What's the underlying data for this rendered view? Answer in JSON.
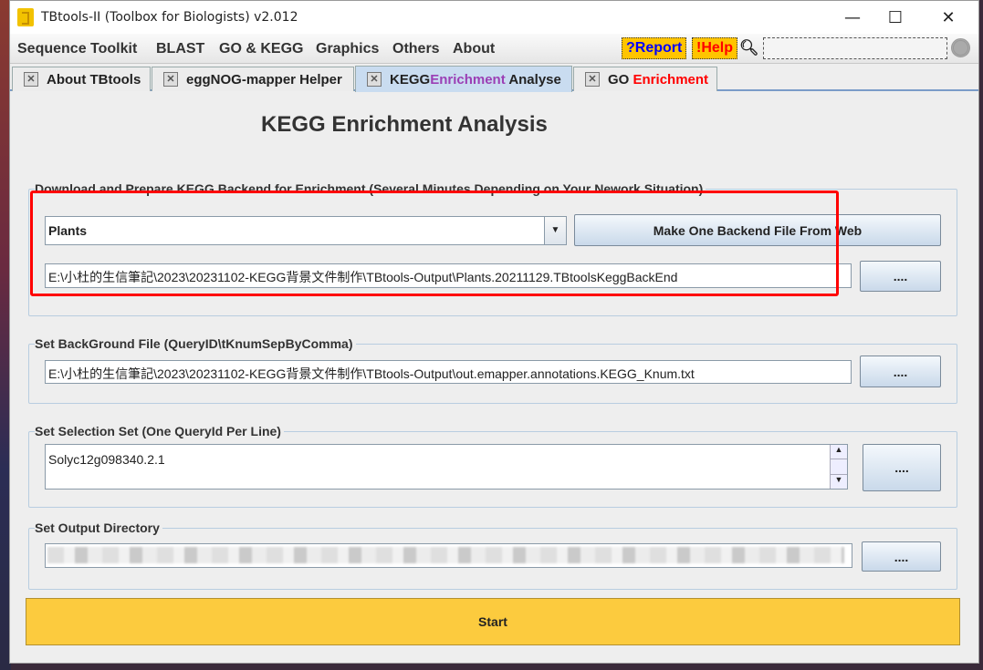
{
  "window": {
    "title": "TBtools-II (Toolbox for Biologists) v2.012",
    "minimize": "—",
    "maximize": "☐",
    "close": "✕"
  },
  "menu": {
    "items": [
      "Sequence Toolkit",
      "BLAST",
      "GO & KEGG",
      "Graphics",
      "Others",
      "About"
    ],
    "report": "?Report",
    "help": "!Help",
    "search_icon": "search-icon",
    "search_value": ""
  },
  "tabs": [
    {
      "pre": "About TBtools",
      "mid": "",
      "post": ""
    },
    {
      "pre": "eggNOG-mapper Helper",
      "mid": "",
      "post": ""
    },
    {
      "pre": "KEGG ",
      "mid": "Enrichment",
      "post": " Analyse",
      "mid_color": "#9b3fb5",
      "active": true
    },
    {
      "pre": "GO ",
      "mid": "Enrichment",
      "post": "",
      "mid_color": "#ff0000"
    }
  ],
  "page": {
    "heading": "KEGG Enrichment Analysis",
    "backend": {
      "label": "Download and Prepare KEGG Backend for Enrichment (Several Minutes Depending on Your Nework Situation)",
      "species": "Plants",
      "make_button": "Make One Backend File From Web",
      "path": "E:\\小杜的生信筆記\\2023\\20231102-KEGG背景文件制作\\TBtools-Output\\Plants.20211129.TBtoolsKeggBackEnd",
      "browse": "...."
    },
    "background": {
      "label": "Set BackGround File (QueryID\\tKnumSepByComma)",
      "path": "E:\\小杜的生信筆記\\2023\\20231102-KEGG背景文件制作\\TBtools-Output\\out.emapper.annotations.KEGG_Knum.txt",
      "browse": "...."
    },
    "selection": {
      "label": "Set Selection Set (One QueryId Per Line)",
      "value": "Solyc12g098340.2.1",
      "browse": "...."
    },
    "output": {
      "label": "Set Output Directory",
      "browse": "...."
    },
    "start": "Start"
  },
  "colors": {
    "start": "#fccb3e",
    "highlight": "#ff0000",
    "report_text": "#0000ff",
    "help_text": "#ff0000"
  }
}
